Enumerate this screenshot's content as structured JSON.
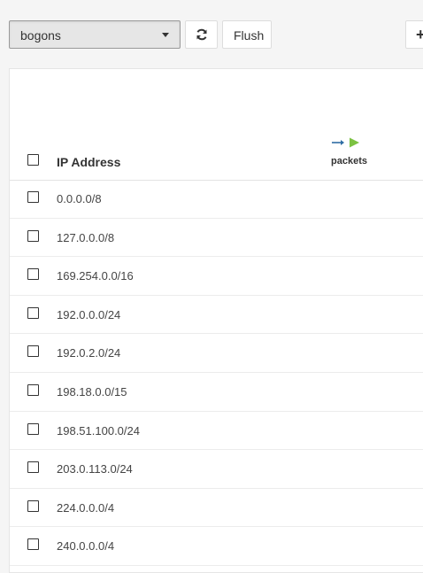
{
  "toolbar": {
    "alias_select": {
      "selected": "bogons"
    },
    "refresh_button": {
      "icon": "refresh-icon"
    },
    "flush_button": {
      "label": "Flush"
    },
    "add_button": {
      "icon": "plus-icon",
      "label": "+"
    }
  },
  "table": {
    "columns": {
      "ip_address": "IP Address",
      "packets": "packets"
    },
    "packets_icons": {
      "out_arrow": "arrow-right-icon",
      "play": "play-icon",
      "arrow_color": "#2e6da4",
      "play_color": "#7cc242"
    },
    "rows": [
      {
        "ip": "0.0.0.0/8"
      },
      {
        "ip": "127.0.0.0/8"
      },
      {
        "ip": "169.254.0.0/16"
      },
      {
        "ip": "192.0.0.0/24"
      },
      {
        "ip": "192.0.2.0/24"
      },
      {
        "ip": "198.18.0.0/15"
      },
      {
        "ip": "198.51.100.0/24"
      },
      {
        "ip": "203.0.113.0/24"
      },
      {
        "ip": "224.0.0.0/4"
      },
      {
        "ip": "240.0.0.0/4"
      }
    ]
  }
}
